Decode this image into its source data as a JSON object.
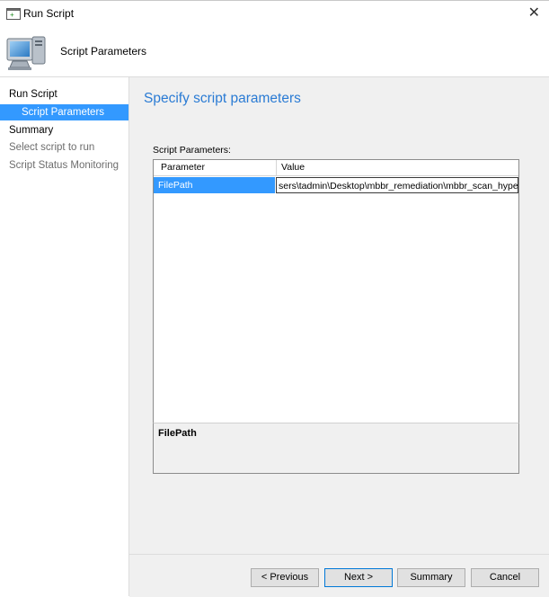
{
  "window": {
    "title": "Run Script",
    "icon": "window-app-icon",
    "close_glyph": "✕"
  },
  "header": {
    "icon": "computer-icon",
    "heading": "Script Parameters"
  },
  "sidebar": {
    "items": [
      {
        "label": "Run Script",
        "state": "main"
      },
      {
        "label": "Script Parameters",
        "state": "active"
      },
      {
        "label": "Summary",
        "state": "main"
      },
      {
        "label": "Select script to run",
        "state": "disabled"
      },
      {
        "label": "Script Status Monitoring",
        "state": "disabled"
      }
    ]
  },
  "main": {
    "page_title": "Specify script parameters",
    "params_label": "Script Parameters:",
    "grid": {
      "columns": [
        "Parameter",
        "Value"
      ],
      "rows": [
        {
          "name": "FilePath",
          "value": "sers\\tadmin\\Desktop\\mbbr_remediation\\mbbr_scan_hyper.bat"
        }
      ]
    },
    "description_title": "FilePath"
  },
  "footer": {
    "previous": "< Previous",
    "next": "Next >",
    "summary": "Summary",
    "cancel": "Cancel"
  },
  "colors": {
    "accent": "#3399ff",
    "title_blue": "#2a7bd4",
    "panel_bg": "#f0f0f0"
  }
}
